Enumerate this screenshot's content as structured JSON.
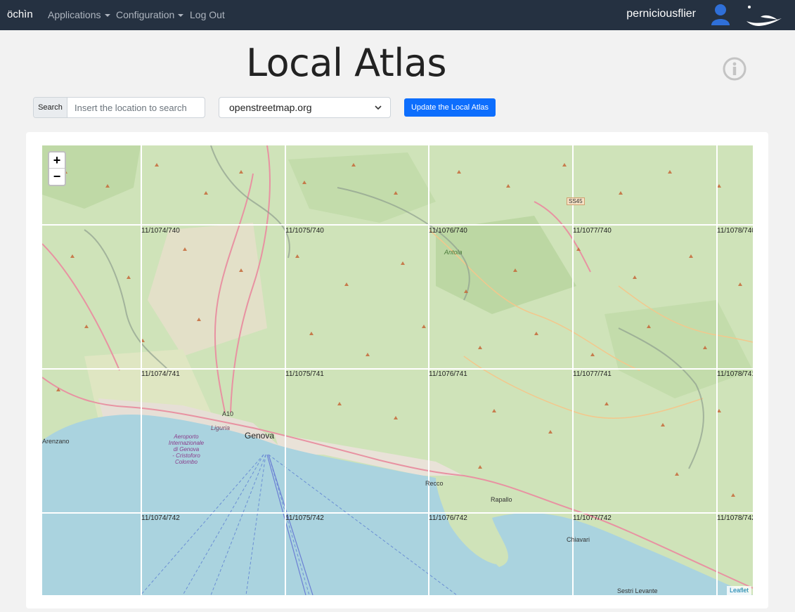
{
  "navbar": {
    "brand": "öchìn",
    "items": [
      {
        "label": "Applications"
      },
      {
        "label": "Configuration"
      },
      {
        "label": "Log Out"
      }
    ],
    "username": "perniciousflier",
    "logo_text": "öchìn"
  },
  "page": {
    "title": "Local Atlas"
  },
  "controls": {
    "search_label": "Search",
    "search_placeholder": "Insert the location to search",
    "search_value": "",
    "provider_selected": "openstreetmap.org",
    "update_label": "Update the Local Atlas"
  },
  "map": {
    "tile_labels": [
      "11/1074/740",
      "11/1075/740",
      "11/1076/740",
      "11/1077/740",
      "11/1078/740",
      "11/1074/741",
      "11/1075/741",
      "11/1076/741",
      "11/1077/741",
      "11/1078/741",
      "11/1074/742",
      "11/1075/742",
      "11/1076/742",
      "11/1077/742",
      "11/1078/742"
    ],
    "places": {
      "arenzano": "Arenzano",
      "genova": "Genova",
      "airport_1": "Aeroporto",
      "airport_2": "Internazionale",
      "airport_3": "di Genova",
      "airport_4": "- Cristoforo",
      "airport_5": "Colombo",
      "recco": "Recco",
      "rapallo": "Rapallo",
      "chiavari": "Chiavari",
      "sestri": "Sestri Levante",
      "antola": "Antola",
      "liguria": "Liguria",
      "a10": "A10",
      "ss45": "SS45"
    },
    "zoom_in": "+",
    "zoom_out": "−",
    "attribution": "Leaflet",
    "colors": {
      "land": "#cfe3b9",
      "sea": "#aad3df",
      "urban": "#e8e0d8",
      "road": "#e892a2"
    }
  }
}
